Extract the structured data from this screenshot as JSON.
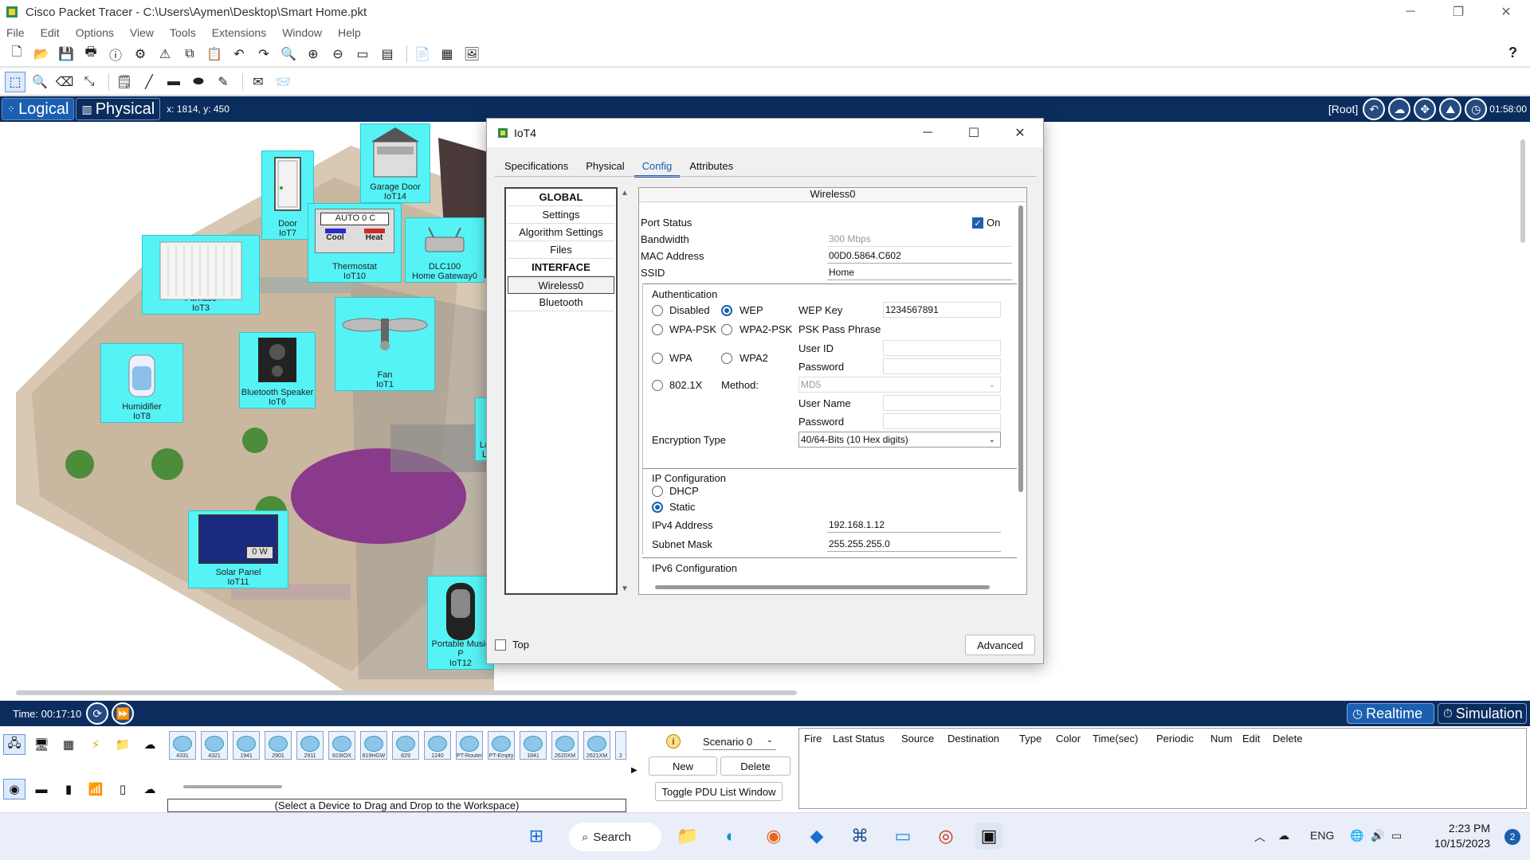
{
  "window": {
    "title": "Cisco Packet Tracer - C:\\Users\\Aymen\\Desktop\\Smart Home.pkt"
  },
  "menu": [
    "File",
    "Edit",
    "Options",
    "View",
    "Tools",
    "Extensions",
    "Window",
    "Help"
  ],
  "help_label": "?",
  "mode_bar": {
    "logical": "Logical",
    "physical": "Physical",
    "coords": "x: 1814, y: 450",
    "root": "[Root]",
    "clock": "01:58:00"
  },
  "devices": [
    {
      "name": "Garage Door",
      "id": "IoT14"
    },
    {
      "name": "Door",
      "id": "IoT7"
    },
    {
      "name": "Thermostat",
      "id": "IoT10"
    },
    {
      "name": "DLC100",
      "id": "Home Gateway0"
    },
    {
      "name": "Furnace",
      "id": "IoT3"
    },
    {
      "name": "Fan",
      "id": "IoT1"
    },
    {
      "name": "Humidifier",
      "id": "IoT8"
    },
    {
      "name": "Bluetooth Speaker",
      "id": "IoT6"
    },
    {
      "name": "Solar Panel",
      "id": "IoT11"
    },
    {
      "name": "Portable Music P",
      "id": "IoT12"
    }
  ],
  "thermostat": {
    "display": "AUTO 0 C",
    "cool": "Cool",
    "heat": "Heat"
  },
  "solar_panel": {
    "reading": "0 W"
  },
  "side_device": {
    "line1": "La",
    "line2": "L"
  },
  "dialog": {
    "title": "IoT4",
    "tabs": [
      "Specifications",
      "Physical",
      "Config",
      "Attributes"
    ],
    "active_tab": "Config",
    "left_items": [
      {
        "label": "GLOBAL",
        "header": true
      },
      {
        "label": "Settings"
      },
      {
        "label": "Algorithm Settings"
      },
      {
        "label": "Files"
      },
      {
        "label": "INTERFACE",
        "header": true
      },
      {
        "label": "Wireless0",
        "selected": true
      },
      {
        "label": "Bluetooth"
      }
    ],
    "interface": {
      "header": "Wireless0",
      "port_status_label": "Port Status",
      "port_status_on": "On",
      "bandwidth_label": "Bandwidth",
      "bandwidth_value": "300 Mbps",
      "mac_label": "MAC Address",
      "mac_value": "00D0.5864.C602",
      "ssid_label": "SSID",
      "ssid_value": "Home",
      "auth": {
        "title": "Authentication",
        "disabled": "Disabled",
        "wep": "WEP",
        "wep_key_label": "WEP Key",
        "wep_key_value": "1234567891",
        "wpa_psk": "WPA-PSK",
        "wpa2_psk": "WPA2-PSK",
        "psk_label": "PSK Pass Phrase",
        "wpa": "WPA",
        "wpa2": "WPA2",
        "user_id_label": "User ID",
        "password_label": "Password",
        "dot1x": "802.1X",
        "method_label": "Method:",
        "method_value": "MD5",
        "user_name_label": "User Name",
        "password2_label": "Password",
        "encryption_label": "Encryption Type",
        "encryption_value": "40/64-Bits (10 Hex digits)"
      },
      "ip": {
        "title": "IP Configuration",
        "dhcp": "DHCP",
        "static": "Static",
        "ipv4_label": "IPv4 Address",
        "ipv4_value": "192.168.1.12",
        "subnet_label": "Subnet Mask",
        "subnet_value": "255.255.255.0"
      },
      "ipv6_title": "IPv6 Configuration"
    },
    "top_label": "Top",
    "advanced_label": "Advanced"
  },
  "timebar": {
    "time": "Time: 00:17:10",
    "realtime": "Realtime",
    "simulation": "Simulation"
  },
  "device_tiles": [
    "4331",
    "4321",
    "1941",
    "2901",
    "2911",
    "819IOX",
    "819HGW",
    "829",
    "1240",
    "PT-Router",
    "PT-Empty",
    "1841",
    "2620XM",
    "2621XM",
    "2"
  ],
  "select_hint": "(Select a Device to Drag and Drop to the Workspace)",
  "scenario": {
    "value": "Scenario 0",
    "new": "New",
    "delete": "Delete",
    "toggle": "Toggle PDU List Window"
  },
  "pdu_columns": [
    "Fire",
    "Last Status",
    "Source",
    "Destination",
    "Type",
    "Color",
    "Time(sec)",
    "Periodic",
    "Num",
    "Edit",
    "Delete"
  ],
  "taskbar": {
    "search": "Search",
    "lang": "ENG",
    "time": "2:23 PM",
    "date": "10/15/2023",
    "notifications": "2"
  }
}
